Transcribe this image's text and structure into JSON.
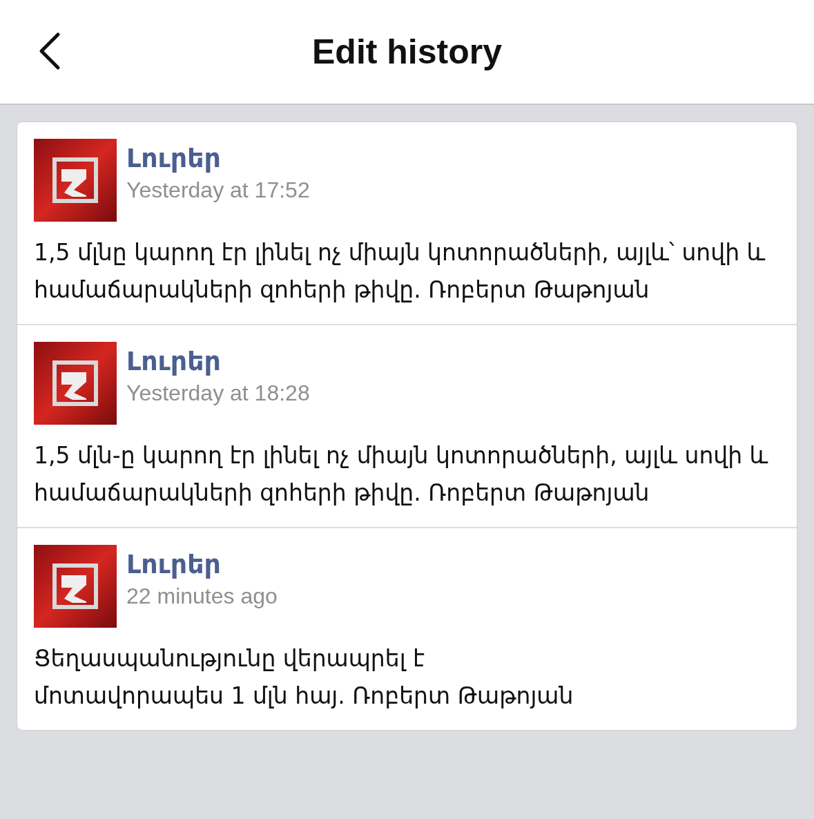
{
  "header": {
    "title": "Edit history"
  },
  "entries": [
    {
      "author": "Լուրեր",
      "time": "Yesterday at 17:52",
      "text": "1,5 մլնը կարող էր լինել ոչ միայն կոտորածների, այլև՝ սովի և համաճարակների զոհերի թիվը. Ռոբերտ Թաթոյան"
    },
    {
      "author": "Լուրեր",
      "time": "Yesterday at 18:28",
      "text": "1,5 մլն-ը կարող էր լինել ոչ միայն կոտորածների, այլև սովի և համաճարակների զոհերի թիվը. Ռոբերտ Թաթոյան"
    },
    {
      "author": "Լուրեր",
      "time": "22 minutes ago",
      "text": "Ցեղասպանությունը վերապրել է\nմոտավորապես 1 մլն հայ. Ռոբերտ Թաթոյան"
    }
  ]
}
